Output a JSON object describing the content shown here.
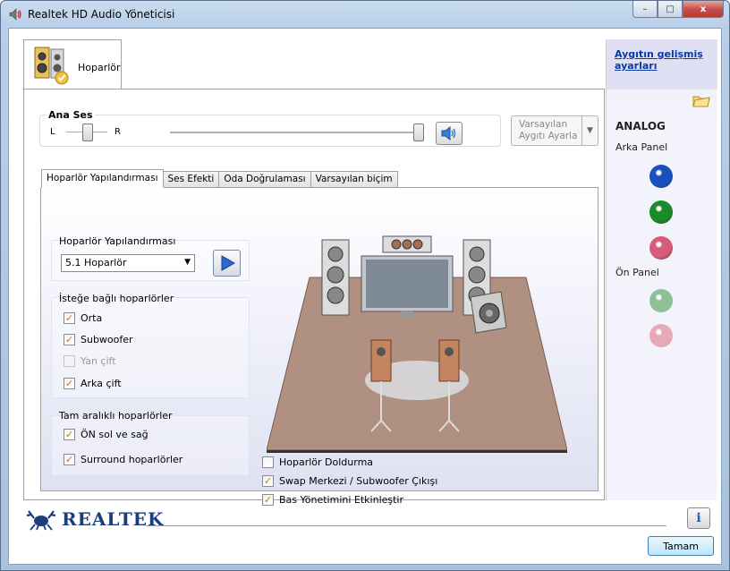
{
  "window": {
    "title": "Realtek HD Audio Yöneticisi",
    "buttons": {
      "minimize": "–",
      "maximize": "□",
      "close": "x"
    }
  },
  "device_tab": {
    "label": "Hoparlör",
    "icon": "speaker-device-icon"
  },
  "sidebar": {
    "advanced_link": "Aygıtın gelişmiş ayarları",
    "analog_title": "ANALOG",
    "back_panel_label": "Arka Panel",
    "front_panel_label": "Ön Panel",
    "back_jacks": [
      {
        "name": "blue",
        "color": "#1a4fc0"
      },
      {
        "name": "green",
        "color": "#1a8a2a"
      },
      {
        "name": "pink",
        "color": "#d85c7a"
      }
    ],
    "front_jacks": [
      {
        "name": "green-inactive",
        "color": "#8fbf98"
      },
      {
        "name": "pink-inactive",
        "color": "#e7a8b7"
      }
    ]
  },
  "volume": {
    "legend": "Ana Ses",
    "left_label": "L",
    "right_label": "R",
    "balance": 0.5,
    "level": 1.0
  },
  "default_device": {
    "label_line1": "Varsayılan",
    "label_line2": "Aygıtı Ayarla"
  },
  "subtabs": [
    {
      "label": "Hoparlör Yapılandırması",
      "active": true
    },
    {
      "label": "Ses Efekti",
      "active": false
    },
    {
      "label": "Oda Doğrulaması",
      "active": false
    },
    {
      "label": "Varsayılan biçim",
      "active": false
    }
  ],
  "speaker_config": {
    "group_title": "Hoparlör Yapılandırması",
    "selected": "5.1 Hoparlör"
  },
  "optional_speakers": {
    "group_title": "İsteğe bağlı hoparlörler",
    "items": [
      {
        "label": "Orta",
        "checked": true,
        "enabled": true
      },
      {
        "label": "Subwoofer",
        "checked": true,
        "enabled": true
      },
      {
        "label": "Yan çift",
        "checked": false,
        "enabled": false
      },
      {
        "label": "Arka çift",
        "checked": true,
        "enabled": true
      }
    ]
  },
  "fullrange_speakers": {
    "group_title": "Tam aralıklı hoparlörler",
    "items": [
      {
        "label": "ÖN sol ve sağ",
        "checked": true
      },
      {
        "label": "Surround hoparlörler",
        "checked": true
      }
    ]
  },
  "bottom_options": [
    {
      "label": "Hoparlör Doldurma",
      "checked": false
    },
    {
      "label": "Swap Merkezi / Subwoofer Çıkışı",
      "checked": true
    },
    {
      "label": "Bas Yönetimini Etkinleştir",
      "checked": true
    }
  ],
  "footer": {
    "logo_text": "REALTEK",
    "info_button": "i",
    "ok_button": "Tamam"
  }
}
